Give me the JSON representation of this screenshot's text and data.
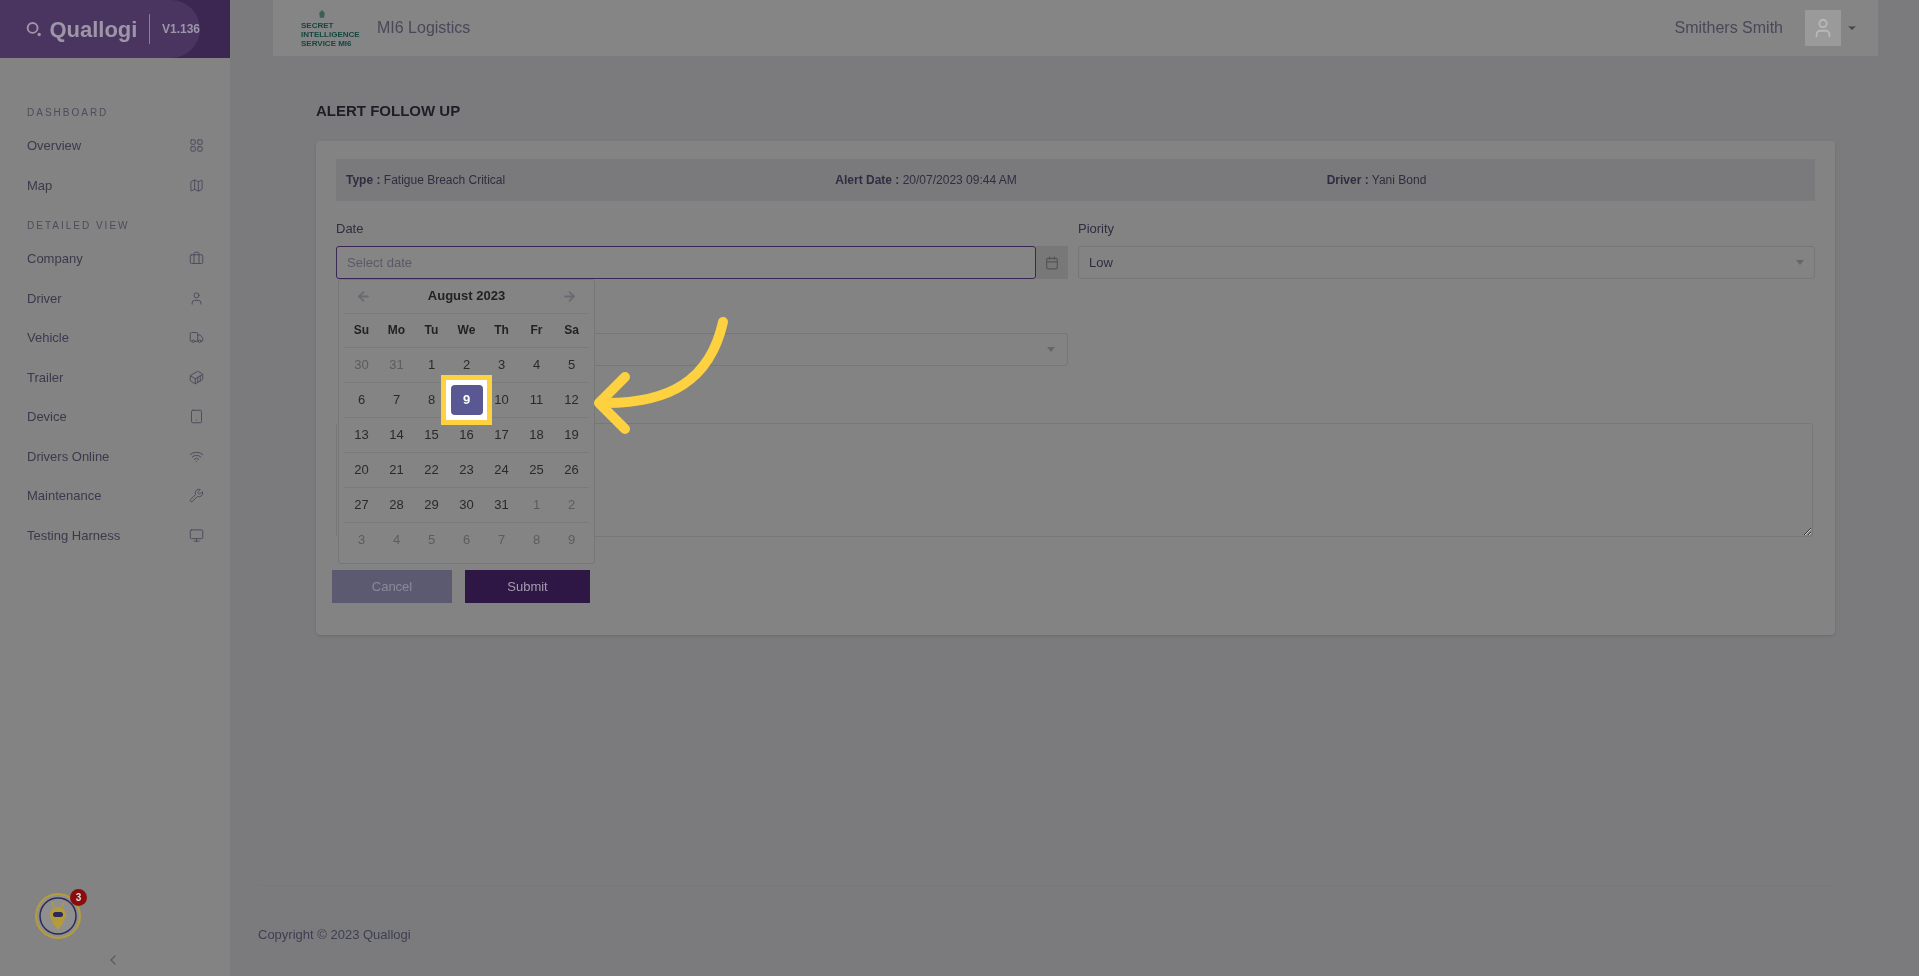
{
  "sidebar": {
    "brand": "Quallogi",
    "version": "V1.136",
    "sections": [
      {
        "title": "DASHBOARD",
        "items": [
          {
            "label": "Overview"
          },
          {
            "label": "Map"
          }
        ]
      },
      {
        "title": "DETAILED VIEW",
        "items": [
          {
            "label": "Company"
          },
          {
            "label": "Driver"
          },
          {
            "label": "Vehicle"
          },
          {
            "label": "Trailer"
          },
          {
            "label": "Device"
          },
          {
            "label": "Drivers Online"
          },
          {
            "label": "Maintenance"
          },
          {
            "label": "Testing Harness"
          }
        ]
      }
    ],
    "assistant_badge": "3"
  },
  "header": {
    "logo_text": [
      "SECRET",
      "INTELLIGENCE",
      "SERVICE MI6"
    ],
    "company": "MI6 Logistics",
    "user": "Smithers Smith"
  },
  "page_title": "ALERT FOLLOW UP",
  "info": [
    {
      "label": "Type :",
      "value": "Fatigue Breach Critical"
    },
    {
      "label": "Alert Date :",
      "value": "20/07/2023 09:44 AM"
    },
    {
      "label": "Driver :",
      "value": "Yani Bond"
    }
  ],
  "form": {
    "date_label": "Date",
    "date_placeholder": "Select date",
    "priority_label": "Piority",
    "priority_value": "Low"
  },
  "calendar": {
    "month": "August 2023",
    "weekdays": [
      "Su",
      "Mo",
      "Tu",
      "We",
      "Th",
      "Fr",
      "Sa"
    ],
    "weeks": [
      [
        {
          "label": "30",
          "kind": "other",
          "selected": false
        },
        {
          "label": "31",
          "kind": "other",
          "selected": false
        },
        {
          "label": "1",
          "kind": "current",
          "selected": false
        },
        {
          "label": "2",
          "kind": "current",
          "selected": false
        },
        {
          "label": "3",
          "kind": "current",
          "selected": false
        },
        {
          "label": "4",
          "kind": "current",
          "selected": false
        },
        {
          "label": "5",
          "kind": "current",
          "selected": false
        }
      ],
      [
        {
          "label": "6",
          "kind": "current",
          "selected": false
        },
        {
          "label": "7",
          "kind": "current",
          "selected": false
        },
        {
          "label": "8",
          "kind": "current",
          "selected": false
        },
        {
          "label": "9",
          "kind": "current",
          "selected": true
        },
        {
          "label": "10",
          "kind": "current",
          "selected": false
        },
        {
          "label": "11",
          "kind": "current",
          "selected": false
        },
        {
          "label": "12",
          "kind": "current",
          "selected": false
        }
      ],
      [
        {
          "label": "13",
          "kind": "current",
          "selected": false
        },
        {
          "label": "14",
          "kind": "current",
          "selected": false
        },
        {
          "label": "15",
          "kind": "current",
          "selected": false
        },
        {
          "label": "16",
          "kind": "current",
          "selected": false
        },
        {
          "label": "17",
          "kind": "current",
          "selected": false
        },
        {
          "label": "18",
          "kind": "current",
          "selected": false
        },
        {
          "label": "19",
          "kind": "current",
          "selected": false
        }
      ],
      [
        {
          "label": "20",
          "kind": "current",
          "selected": false
        },
        {
          "label": "21",
          "kind": "current",
          "selected": false
        },
        {
          "label": "22",
          "kind": "current",
          "selected": false
        },
        {
          "label": "23",
          "kind": "current",
          "selected": false
        },
        {
          "label": "24",
          "kind": "current",
          "selected": false
        },
        {
          "label": "25",
          "kind": "current",
          "selected": false
        },
        {
          "label": "26",
          "kind": "current",
          "selected": false
        }
      ],
      [
        {
          "label": "27",
          "kind": "current",
          "selected": false
        },
        {
          "label": "28",
          "kind": "current",
          "selected": false
        },
        {
          "label": "29",
          "kind": "current",
          "selected": false
        },
        {
          "label": "30",
          "kind": "current",
          "selected": false
        },
        {
          "label": "31",
          "kind": "current",
          "selected": false
        },
        {
          "label": "1",
          "kind": "other",
          "selected": false
        },
        {
          "label": "2",
          "kind": "other",
          "selected": false
        }
      ],
      [
        {
          "label": "3",
          "kind": "other",
          "selected": false
        },
        {
          "label": "4",
          "kind": "other",
          "selected": false
        },
        {
          "label": "5",
          "kind": "other",
          "selected": false
        },
        {
          "label": "6",
          "kind": "other",
          "selected": false
        },
        {
          "label": "7",
          "kind": "other",
          "selected": false
        },
        {
          "label": "8",
          "kind": "other",
          "selected": false
        },
        {
          "label": "9",
          "kind": "other",
          "selected": false
        }
      ]
    ]
  },
  "buttons": {
    "cancel": "Cancel",
    "submit": "Submit"
  },
  "footer": "Copyright © 2023 Quallogi"
}
